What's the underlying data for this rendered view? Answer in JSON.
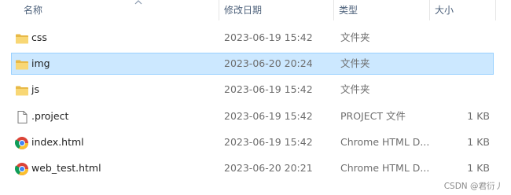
{
  "columns": {
    "name": "名称",
    "date": "修改日期",
    "type": "类型",
    "size": "大小"
  },
  "files": [
    {
      "icon": "folder-icon",
      "name": "css",
      "date": "2023-06-19 15:42",
      "type": "文件夹",
      "size": "",
      "selected": false
    },
    {
      "icon": "folder-icon",
      "name": "img",
      "date": "2023-06-20 20:24",
      "type": "文件夹",
      "size": "",
      "selected": true
    },
    {
      "icon": "folder-icon",
      "name": "js",
      "date": "2023-06-19 15:42",
      "type": "文件夹",
      "size": "",
      "selected": false
    },
    {
      "icon": "file-icon",
      "name": ".project",
      "date": "2023-06-19 15:42",
      "type": "PROJECT 文件",
      "size": "1 KB",
      "selected": false
    },
    {
      "icon": "chrome-icon",
      "name": "index.html",
      "date": "2023-06-19 15:42",
      "type": "Chrome HTML D...",
      "size": "1 KB",
      "selected": false
    },
    {
      "icon": "chrome-icon",
      "name": "web_test.html",
      "date": "2023-06-20 20:21",
      "type": "Chrome HTML D...",
      "size": "1 KB",
      "selected": false
    }
  ],
  "colors": {
    "selection": "#cce8ff",
    "selection_border": "#99d1ff",
    "folder": "#f8d775",
    "header_text": "#4c607a"
  },
  "watermark": "CSDN @君衍丿"
}
